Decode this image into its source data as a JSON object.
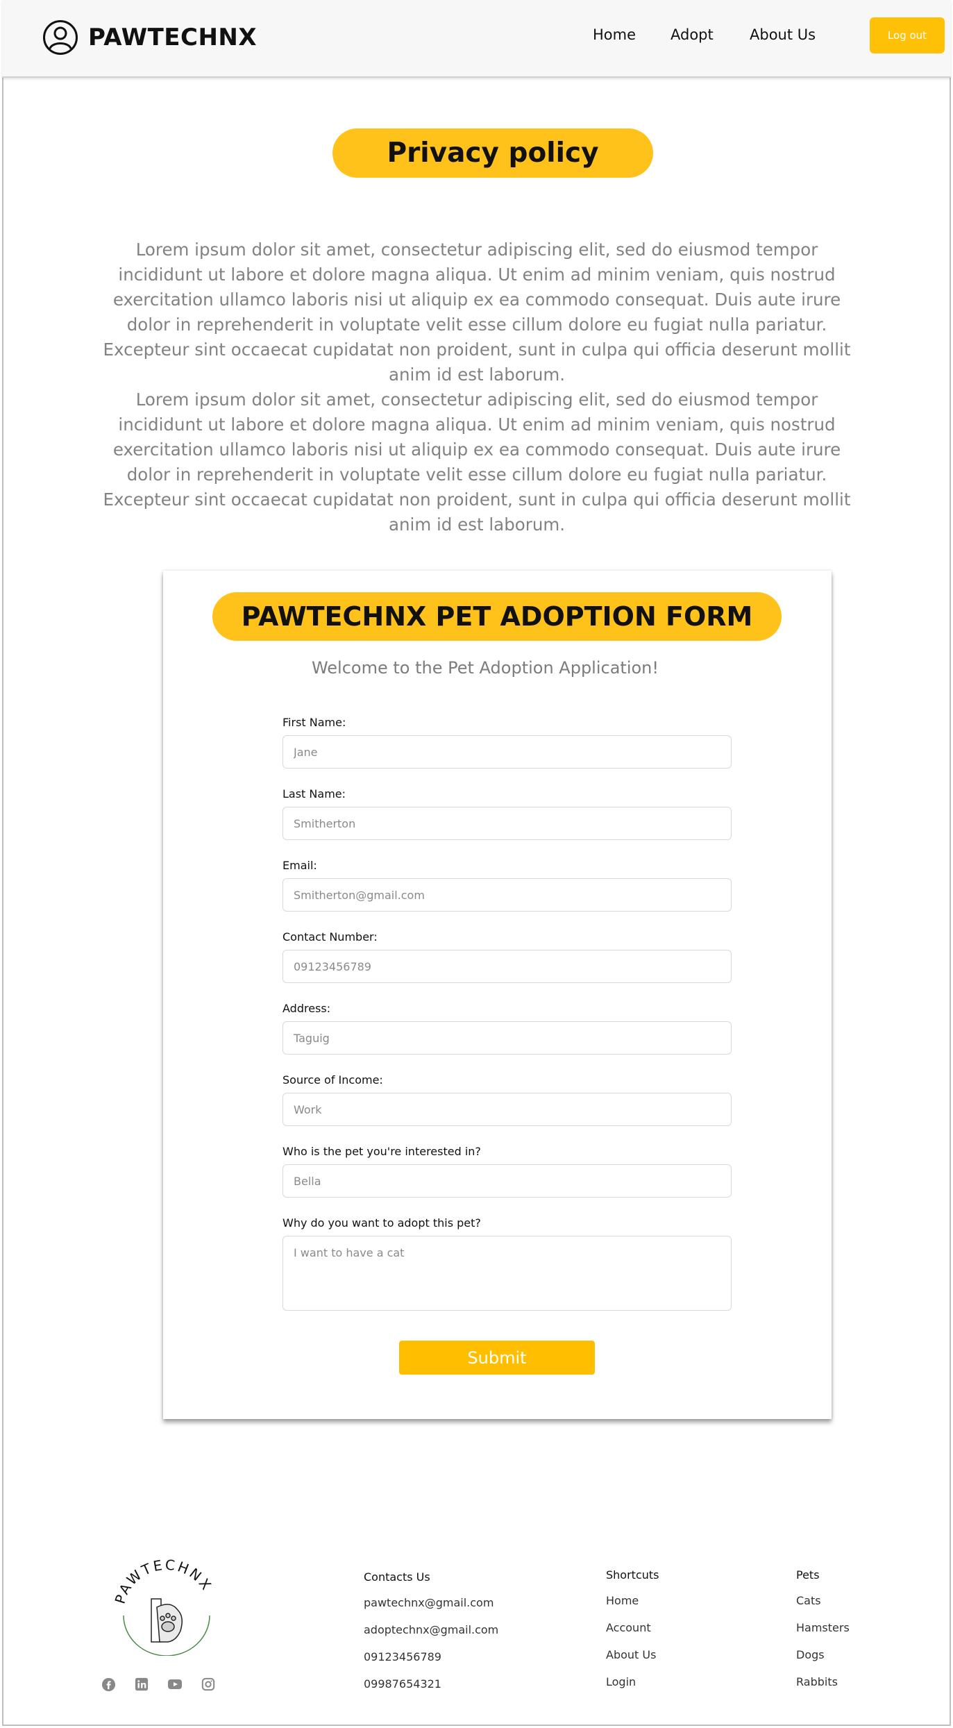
{
  "header": {
    "brand": "PAWTECHNX",
    "nav": [
      "Home",
      "Adopt",
      "About Us"
    ],
    "logout": "Log out"
  },
  "privacy": {
    "title": "Privacy policy",
    "paragraphs": [
      "Lorem ipsum dolor sit amet, consectetur adipiscing elit, sed do eiusmod tempor incididunt ut labore et dolore magna aliqua. Ut enim ad minim veniam, quis nostrud exercitation ullamco laboris nisi ut aliquip ex ea commodo consequat. Duis aute irure dolor in reprehenderit in voluptate velit esse cillum dolore eu fugiat nulla pariatur. Excepteur sint occaecat cupidatat non proident, sunt in culpa qui officia deserunt mollit anim id est laborum.",
      "Lorem ipsum dolor sit amet, consectetur adipiscing elit, sed do eiusmod tempor incididunt ut labore et dolore magna aliqua. Ut enim ad minim veniam, quis nostrud exercitation ullamco laboris nisi ut aliquip ex ea commodo consequat. Duis aute irure dolor in reprehenderit in voluptate velit esse cillum dolore eu fugiat nulla pariatur. Excepteur sint occaecat cupidatat non proident, sunt in culpa qui officia deserunt mollit anim id est laborum."
    ]
  },
  "form": {
    "title": "PAWTECHNX PET ADOPTION FORM",
    "welcome": "Welcome to the Pet Adoption Application!",
    "fields": [
      {
        "label": "First Name:",
        "placeholder": "Jane"
      },
      {
        "label": "Last Name:",
        "placeholder": "Smitherton"
      },
      {
        "label": "Email:",
        "placeholder": "Smitherton@gmail.com"
      },
      {
        "label": "Contact Number:",
        "placeholder": "09123456789"
      },
      {
        "label": "Address:",
        "placeholder": "Taguig"
      },
      {
        "label": "Source of Income:",
        "placeholder": "Work"
      },
      {
        "label": "Who is the pet you're interested in?",
        "placeholder": "Bella"
      },
      {
        "label": "Why do you want to adopt this pet?",
        "placeholder": "I want to have a cat"
      }
    ],
    "submit": "Submit"
  },
  "footer": {
    "logo_text": "PAWTECHNX",
    "socials": [
      "facebook-icon",
      "linkedin-icon",
      "youtube-icon",
      "instagram-icon"
    ],
    "contacts": {
      "heading": "Contacts Us",
      "items": [
        "pawtechnx@gmail.com",
        "adoptechnx@gmail.com",
        "09123456789",
        "09987654321"
      ]
    },
    "shortcuts": {
      "heading": "Shortcuts",
      "items": [
        "Home",
        "Account",
        "About Us",
        "Login"
      ]
    },
    "pets": {
      "heading": "Pets",
      "items": [
        "Cats",
        "Hamsters",
        "Dogs",
        "Rabbits"
      ]
    }
  }
}
